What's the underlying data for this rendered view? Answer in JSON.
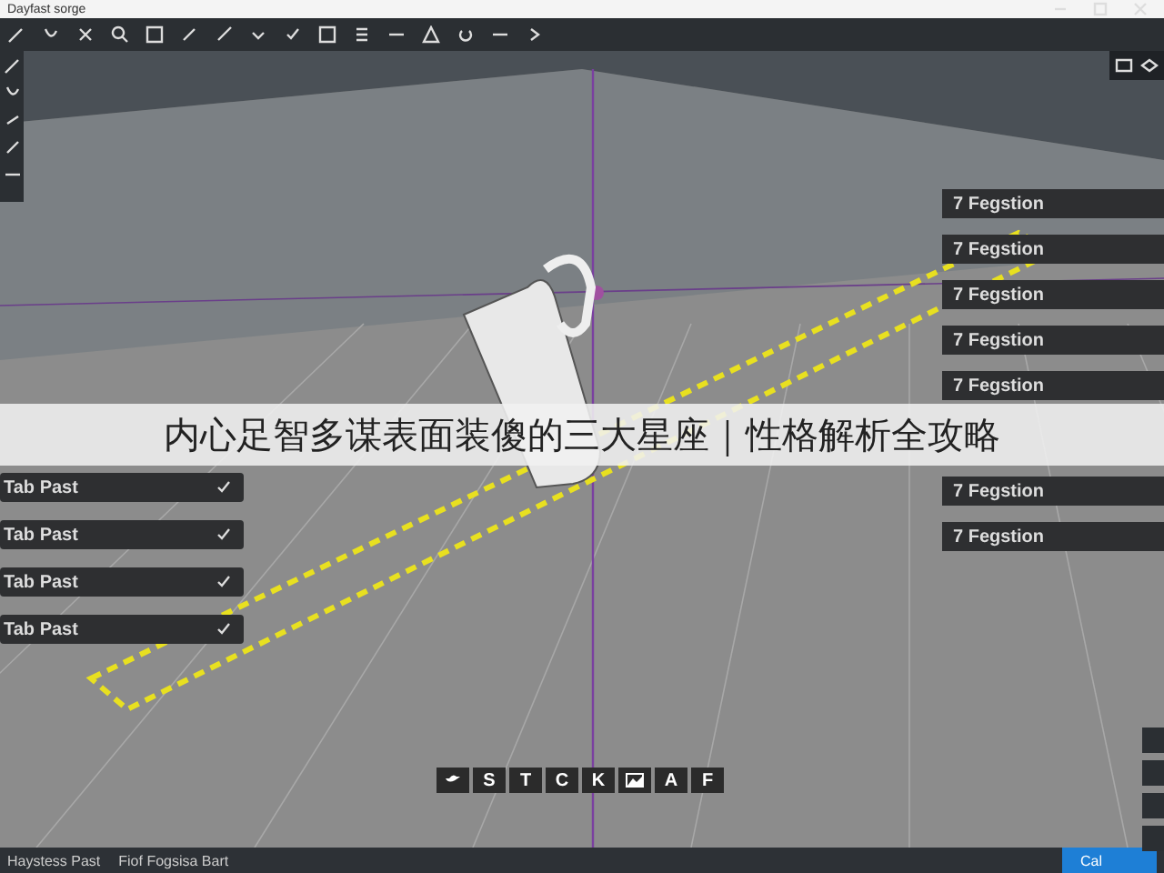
{
  "window": {
    "title": "Dayfast sorge"
  },
  "left_panel": {
    "items": [
      {
        "label": "Tab Past"
      },
      {
        "label": "Tab Past"
      },
      {
        "label": "Tab Past"
      },
      {
        "label": "Tab Past"
      }
    ]
  },
  "right_panel": {
    "items": [
      {
        "label": "7 Fegstion"
      },
      {
        "label": "7 Fegstion"
      },
      {
        "label": "7 Fegstion"
      },
      {
        "label": "7 Fegstion"
      },
      {
        "label": "7 Fegstion"
      },
      {
        "label": "7 Fegstion"
      },
      {
        "label": "7 Fegstion"
      }
    ]
  },
  "bottom_toolbar": [
    {
      "kind": "icon"
    },
    {
      "kind": "letter",
      "label": "S"
    },
    {
      "kind": "letter",
      "label": "T"
    },
    {
      "kind": "letter",
      "label": "C"
    },
    {
      "kind": "letter",
      "label": "K"
    },
    {
      "kind": "image"
    },
    {
      "kind": "letter",
      "label": "A"
    },
    {
      "kind": "letter",
      "label": "F"
    }
  ],
  "banner": {
    "text": "内心足智多谋表面装傻的三大星座｜性格解析全攻略"
  },
  "status_bar": {
    "texts": [
      "Haystess Past",
      "Fiof Fogsisa Bart"
    ],
    "button": "Cal"
  }
}
